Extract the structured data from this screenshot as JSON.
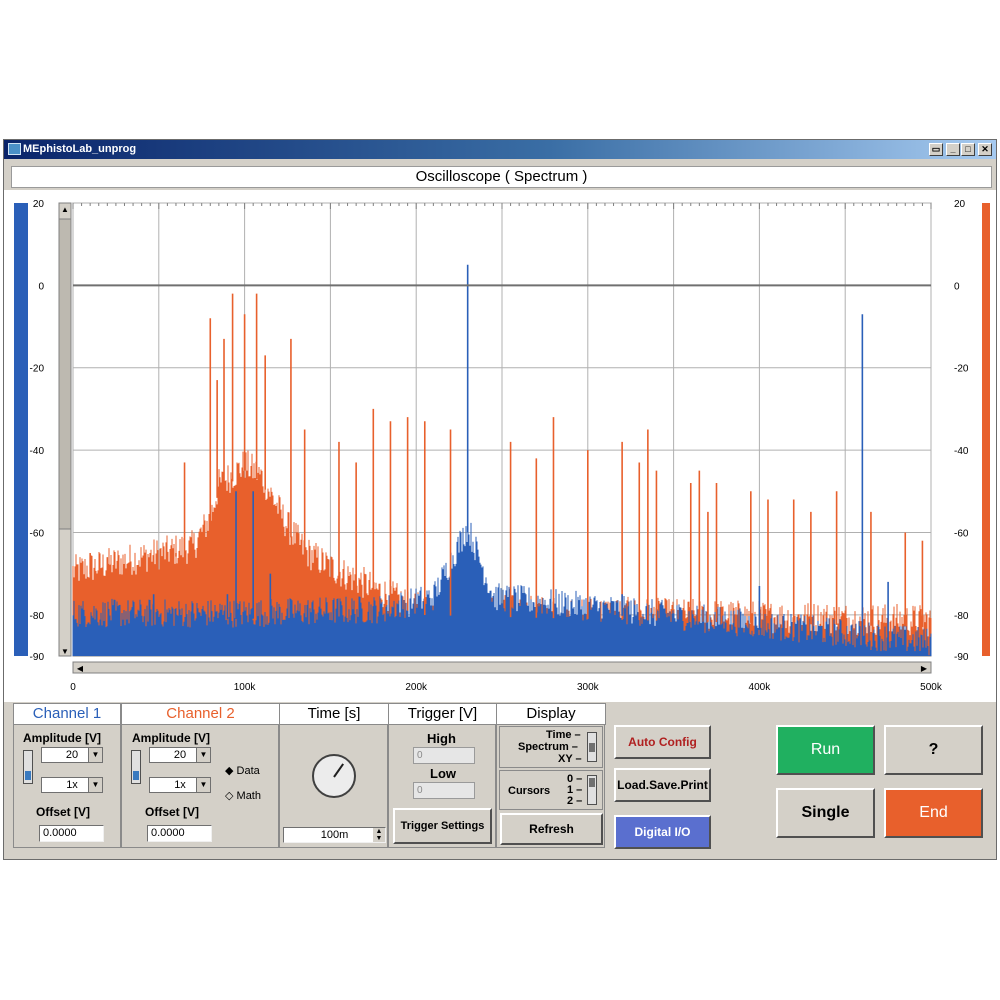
{
  "window": {
    "title": "MEphistoLab_unprog",
    "controls": [
      "restore",
      "minimize",
      "maximize",
      "close"
    ]
  },
  "header": {
    "title": "Oscilloscope ( Spectrum )"
  },
  "colors": {
    "channel1": "#2a5fb8",
    "channel2": "#e8602c",
    "run": "#20b060",
    "end": "#e8602c",
    "digital": "#5a6fcf",
    "autoconfig_text": "#b02020"
  },
  "chart_data": {
    "type": "line",
    "xlabel": "",
    "ylabel": "",
    "xlim": [
      0,
      500000
    ],
    "ylim": [
      -90,
      20
    ],
    "x_ticks": [
      "0",
      "100k",
      "200k",
      "300k",
      "400k",
      "500k"
    ],
    "y_ticks_left": [
      "20",
      "0",
      "-20",
      "-40",
      "-60",
      "-80",
      "-90"
    ],
    "y_ticks_right": [
      "20",
      "0",
      "-20",
      "-40",
      "-60",
      "-80",
      "-90"
    ],
    "grid": true,
    "reference_line": 0,
    "series": [
      {
        "name": "Channel 1",
        "noise_floor": [
          [
            0,
            -81
          ],
          [
            100000,
            -81
          ],
          [
            180000,
            -80
          ],
          [
            210000,
            -77
          ],
          [
            230000,
            -60
          ],
          [
            245000,
            -77
          ],
          [
            500000,
            -88
          ]
        ],
        "peaks": [
          [
            95000,
            -50
          ],
          [
            105000,
            -50
          ],
          [
            47000,
            -75
          ],
          [
            90000,
            -75
          ],
          [
            115000,
            -70
          ],
          [
            230000,
            5
          ],
          [
            320000,
            -75
          ],
          [
            400000,
            -73
          ],
          [
            460000,
            -7
          ],
          [
            475000,
            -72
          ]
        ]
      },
      {
        "name": "Channel 2",
        "noise_floor": [
          [
            0,
            -71
          ],
          [
            70000,
            -65
          ],
          [
            80000,
            -58
          ],
          [
            85000,
            -50
          ],
          [
            95000,
            -47
          ],
          [
            100000,
            -45
          ],
          [
            110000,
            -48
          ],
          [
            125000,
            -60
          ],
          [
            135000,
            -66
          ],
          [
            150000,
            -70
          ],
          [
            175000,
            -75
          ],
          [
            200000,
            -80
          ],
          [
            500000,
            -83
          ]
        ],
        "peaks": [
          [
            10000,
            -65
          ],
          [
            20000,
            -66
          ],
          [
            45000,
            -65
          ],
          [
            60000,
            -65
          ],
          [
            65000,
            -43
          ],
          [
            80000,
            -8
          ],
          [
            84000,
            -23
          ],
          [
            88000,
            -13
          ],
          [
            93000,
            -2
          ],
          [
            100000,
            -7
          ],
          [
            107000,
            -2
          ],
          [
            112000,
            -17
          ],
          [
            127000,
            -13
          ],
          [
            135000,
            -35
          ],
          [
            155000,
            -38
          ],
          [
            165000,
            -43
          ],
          [
            175000,
            -30
          ],
          [
            185000,
            -33
          ],
          [
            195000,
            -32
          ],
          [
            205000,
            -33
          ],
          [
            220000,
            -35
          ],
          [
            255000,
            -38
          ],
          [
            270000,
            -42
          ],
          [
            280000,
            -32
          ],
          [
            300000,
            -40
          ],
          [
            320000,
            -38
          ],
          [
            330000,
            -43
          ],
          [
            335000,
            -35
          ],
          [
            340000,
            -45
          ],
          [
            360000,
            -48
          ],
          [
            365000,
            -45
          ],
          [
            370000,
            -55
          ],
          [
            375000,
            -48
          ],
          [
            395000,
            -50
          ],
          [
            405000,
            -52
          ],
          [
            420000,
            -52
          ],
          [
            430000,
            -55
          ],
          [
            445000,
            -50
          ],
          [
            465000,
            -55
          ],
          [
            485000,
            -60
          ],
          [
            495000,
            -62
          ]
        ]
      }
    ]
  },
  "channel1": {
    "title": "Channel 1",
    "amplitude_label": "Amplitude [V]",
    "amplitude_value": "20",
    "probe_value": "1x",
    "offset_label": "Offset [V]",
    "offset_value": "0.0000"
  },
  "channel2": {
    "title": "Channel 2",
    "amplitude_label": "Amplitude [V]",
    "amplitude_value": "20",
    "probe_value": "1x",
    "offset_label": "Offset [V]",
    "offset_value": "0.0000",
    "radio_data": "Data",
    "radio_math": "Math",
    "selected": "Data"
  },
  "time": {
    "title": "Time [s]",
    "value": "100m"
  },
  "trigger": {
    "title": "Trigger [V]",
    "high_label": "High",
    "high_value": "0",
    "low_label": "Low",
    "low_value": "0",
    "settings_button": "Trigger Settings"
  },
  "display": {
    "title": "Display",
    "modes": [
      "Time",
      "Spectrum",
      "XY"
    ],
    "selected_mode": "Spectrum",
    "cursors_label": "Cursors",
    "cursor_options": [
      "0",
      "1",
      "2"
    ],
    "refresh_button": "Refresh"
  },
  "actions": {
    "auto_config": "Auto Config",
    "load_save_print": "Load.Save.Print",
    "digital_io": "Digital I/O",
    "run": "Run",
    "help": "?",
    "single": "Single",
    "end": "End"
  }
}
